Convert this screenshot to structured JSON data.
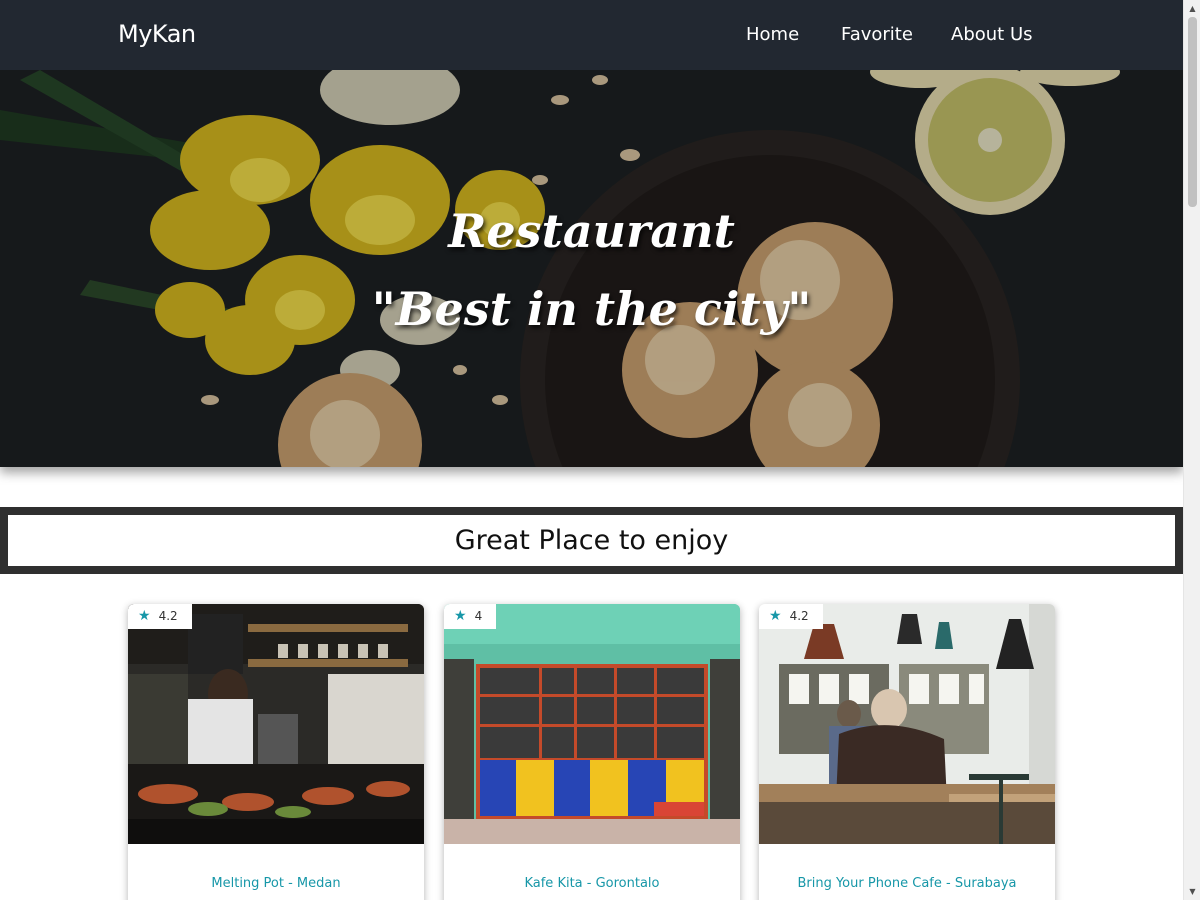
{
  "navbar": {
    "brand": "MyKan",
    "links": [
      "Home",
      "Favorite",
      "About Us"
    ]
  },
  "hero": {
    "line1": "Restaurant",
    "line2": "\"Best in the city\""
  },
  "section": {
    "title": "Great Place to enjoy"
  },
  "cards": [
    {
      "rating": "4.2",
      "name": "Melting Pot - Medan"
    },
    {
      "rating": "4",
      "name": "Kafe Kita - Gorontalo"
    },
    {
      "rating": "4.2",
      "name": "Bring Your Phone Cafe - Surabaya"
    }
  ],
  "icons": {
    "rating": "star-icon",
    "scroll_up": "triangle-up-icon",
    "scroll_down": "triangle-down-icon"
  },
  "colors": {
    "navbar": "#222831",
    "accent": "#1797a8",
    "section_band": "#2f2f2f"
  }
}
